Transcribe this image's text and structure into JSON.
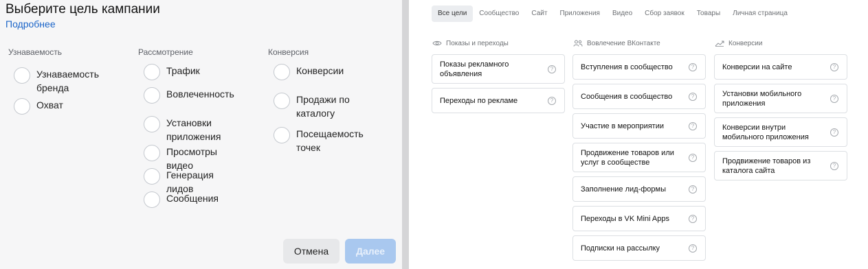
{
  "left": {
    "title": "Выберите цель кампании",
    "more_link": "Подробнее",
    "columns": [
      {
        "header": "Узнаваемость",
        "items": [
          "Узнаваемость бренда",
          "Охват"
        ]
      },
      {
        "header": "Рассмотрение",
        "items": [
          "Трафик",
          "Вовлеченность",
          "Установки приложения",
          "Просмотры видео",
          "Генерация лидов",
          "Сообщения"
        ]
      },
      {
        "header": "Конверсия",
        "items": [
          "Конверсии",
          "Продажи по каталогу",
          "Посещаемость точек"
        ]
      }
    ],
    "cancel_label": "Отмена",
    "next_label": "Далее"
  },
  "right": {
    "tabs": [
      "Все цели",
      "Сообщество",
      "Сайт",
      "Приложения",
      "Видео",
      "Сбор заявок",
      "Товары",
      "Личная страница"
    ],
    "active_tab": "Все цели",
    "groups": [
      {
        "header": "Показы и переходы",
        "icon": "eye-icon",
        "cards": [
          "Показы рекламного объявления",
          "Переходы по рекламе"
        ]
      },
      {
        "header": "Вовлечение ВКонтакте",
        "icon": "people-icon",
        "cards": [
          "Вступления в сообщество",
          "Сообщения в сообщество",
          "Участие в мероприятии",
          "Продвижение товаров или услуг в сообществе",
          "Заполнение лид-формы",
          "Переходы в VK Mini Apps",
          "Подписки на рассылку"
        ]
      },
      {
        "header": "Конверсии",
        "icon": "trend-icon",
        "cards": [
          "Конверсии на сайте",
          "Установки мобильного приложения",
          "Конверсии внутри мобильного приложения",
          "Продвижение товаров из каталога сайта"
        ]
      }
    ],
    "help_glyph": "?"
  }
}
